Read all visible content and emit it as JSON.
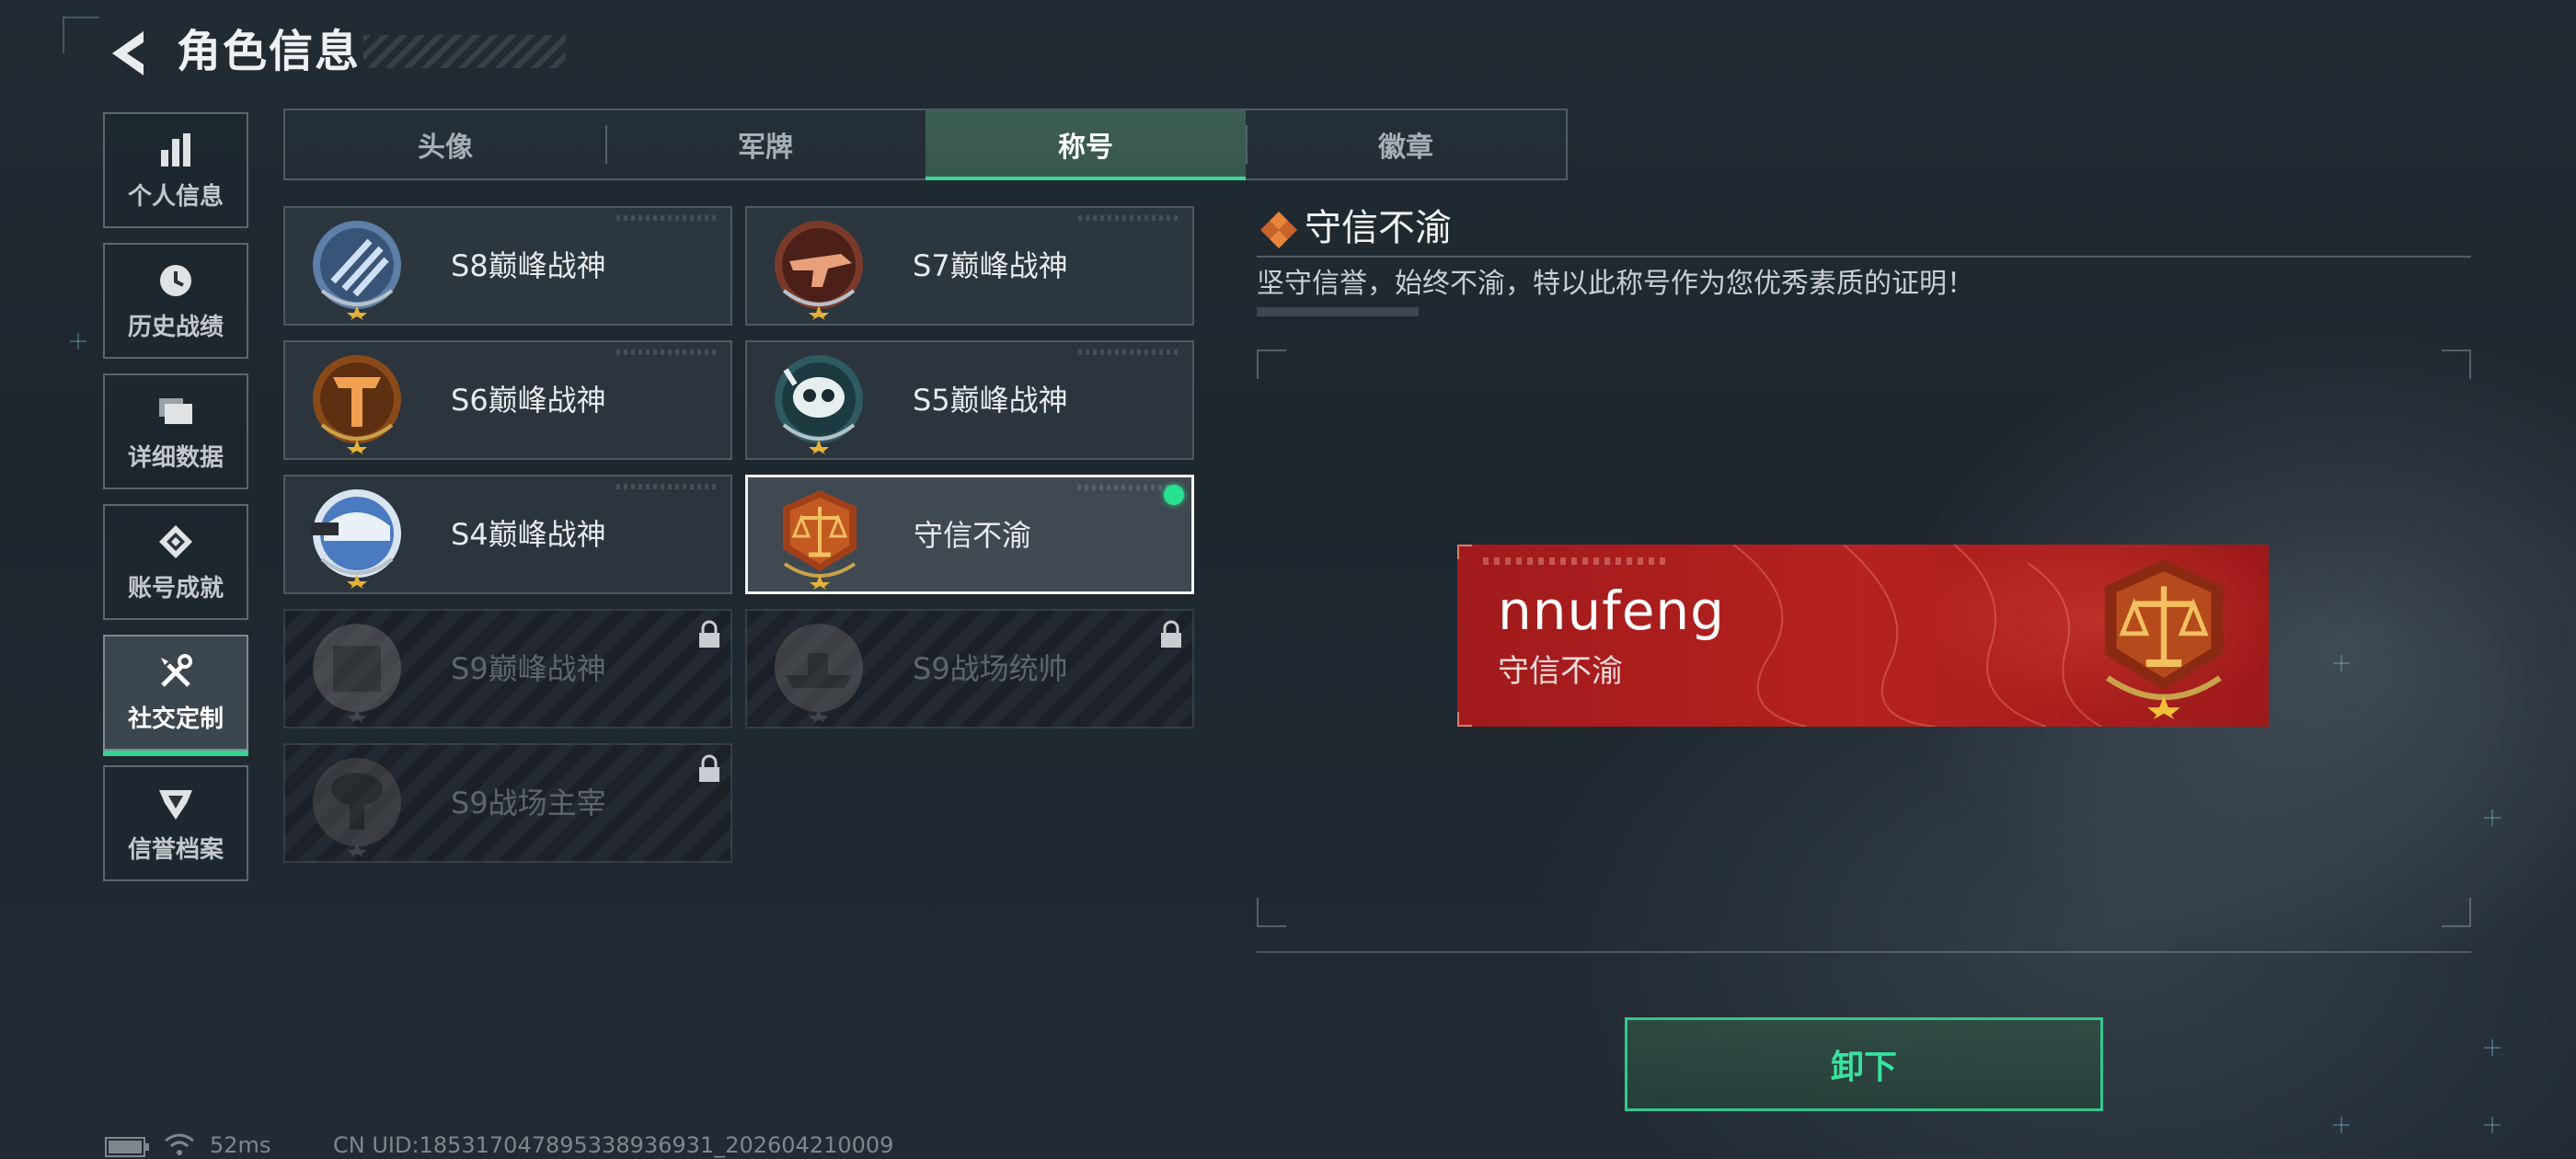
{
  "header": {
    "title": "角色信息"
  },
  "sidebar": {
    "items": [
      {
        "label": "个人信息",
        "icon": "bar-chart-icon"
      },
      {
        "label": "历史战绩",
        "icon": "clock-icon"
      },
      {
        "label": "详细数据",
        "icon": "folder-icon"
      },
      {
        "label": "账号成就",
        "icon": "achievement-icon"
      },
      {
        "label": "社交定制",
        "icon": "tools-icon",
        "active": true
      },
      {
        "label": "信誉档案",
        "icon": "shield-icon"
      }
    ]
  },
  "tabs": [
    {
      "label": "头像"
    },
    {
      "label": "军牌"
    },
    {
      "label": "称号",
      "active": true
    },
    {
      "label": "徽章"
    }
  ],
  "titles": [
    {
      "name": "S8巅峰战神",
      "locked": false
    },
    {
      "name": "S7巅峰战神",
      "locked": false
    },
    {
      "name": "S6巅峰战神",
      "locked": false
    },
    {
      "name": "S5巅峰战神",
      "locked": false
    },
    {
      "name": "S4巅峰战神",
      "locked": false
    },
    {
      "name": "守信不渝",
      "locked": false,
      "selected": true,
      "equipped": true
    },
    {
      "name": "S9巅峰战神",
      "locked": true
    },
    {
      "name": "S9战场统帅",
      "locked": true
    },
    {
      "name": "S9战场主宰",
      "locked": true
    }
  ],
  "detail": {
    "title": "守信不渝",
    "description": "坚守信誉，始终不渝，特以此称号作为您优秀素质的证明！"
  },
  "preview": {
    "nickname": "nnufeng",
    "title": "守信不渝"
  },
  "actions": {
    "unequip_label": "卸下"
  },
  "status": {
    "ping": "52ms",
    "uid": "CN UID:185317047895338936931_202604210009"
  },
  "colors": {
    "accent": "#3bd99a",
    "banner_red": "#b5221f",
    "equipped_dot": "#28e090"
  }
}
